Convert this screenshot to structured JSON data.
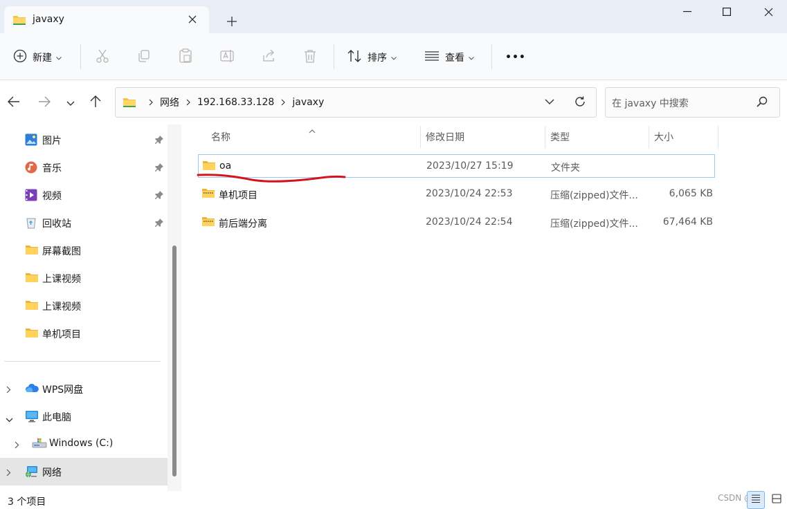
{
  "tab": {
    "title": "javaxy"
  },
  "toolbar": {
    "new_label": "新建",
    "sort_label": "排序",
    "view_label": "查看",
    "more_label": "•••"
  },
  "breadcrumb": [
    "网络",
    "192.168.33.128",
    "javaxy"
  ],
  "search": {
    "placeholder": "在 javaxy 中搜索"
  },
  "sidebar": {
    "items": [
      {
        "label": "图片",
        "icon": "pictures-icon",
        "pinned": true
      },
      {
        "label": "音乐",
        "icon": "music-icon",
        "pinned": true
      },
      {
        "label": "视频",
        "icon": "videos-icon",
        "pinned": true
      },
      {
        "label": "回收站",
        "icon": "recycle-bin-icon",
        "pinned": true
      },
      {
        "label": "屏幕截图",
        "icon": "folder-icon",
        "pinned": false
      },
      {
        "label": "上课视频",
        "icon": "folder-icon",
        "pinned": false
      },
      {
        "label": "上课视频",
        "icon": "folder-icon",
        "pinned": false
      },
      {
        "label": "单机项目",
        "icon": "folder-icon",
        "pinned": false
      }
    ],
    "tree": [
      {
        "label": "WPS网盘",
        "icon": "cloud-icon",
        "expanded": false
      },
      {
        "label": "此电脑",
        "icon": "computer-icon",
        "expanded": true
      },
      {
        "label": "Windows (C:)",
        "icon": "drive-icon",
        "expanded": false
      },
      {
        "label": "网络",
        "icon": "network-icon",
        "expanded": false,
        "selected": true
      }
    ]
  },
  "columns": {
    "name": "名称",
    "modified": "修改日期",
    "type": "类型",
    "size": "大小"
  },
  "files": [
    {
      "name": "oa",
      "modified": "2023/10/27 15:19",
      "type": "文件夹",
      "size": "",
      "icon": "folder-icon",
      "selected": true
    },
    {
      "name": "单机项目",
      "modified": "2023/10/24 22:53",
      "type": "压缩(zipped)文件...",
      "size": "6,065 KB",
      "icon": "zip-folder-icon"
    },
    {
      "name": "前后端分离",
      "modified": "2023/10/24 22:54",
      "type": "压缩(zipped)文件...",
      "size": "67,464 KB",
      "icon": "zip-folder-icon"
    }
  ],
  "status": {
    "item_count": "3 个项目"
  },
  "watermark": "CSDN @hui",
  "colors": {
    "accent": "#0067c0",
    "folder": "#f4c542",
    "annotation": "#d4141c",
    "selection_border": "#99c9ef"
  }
}
